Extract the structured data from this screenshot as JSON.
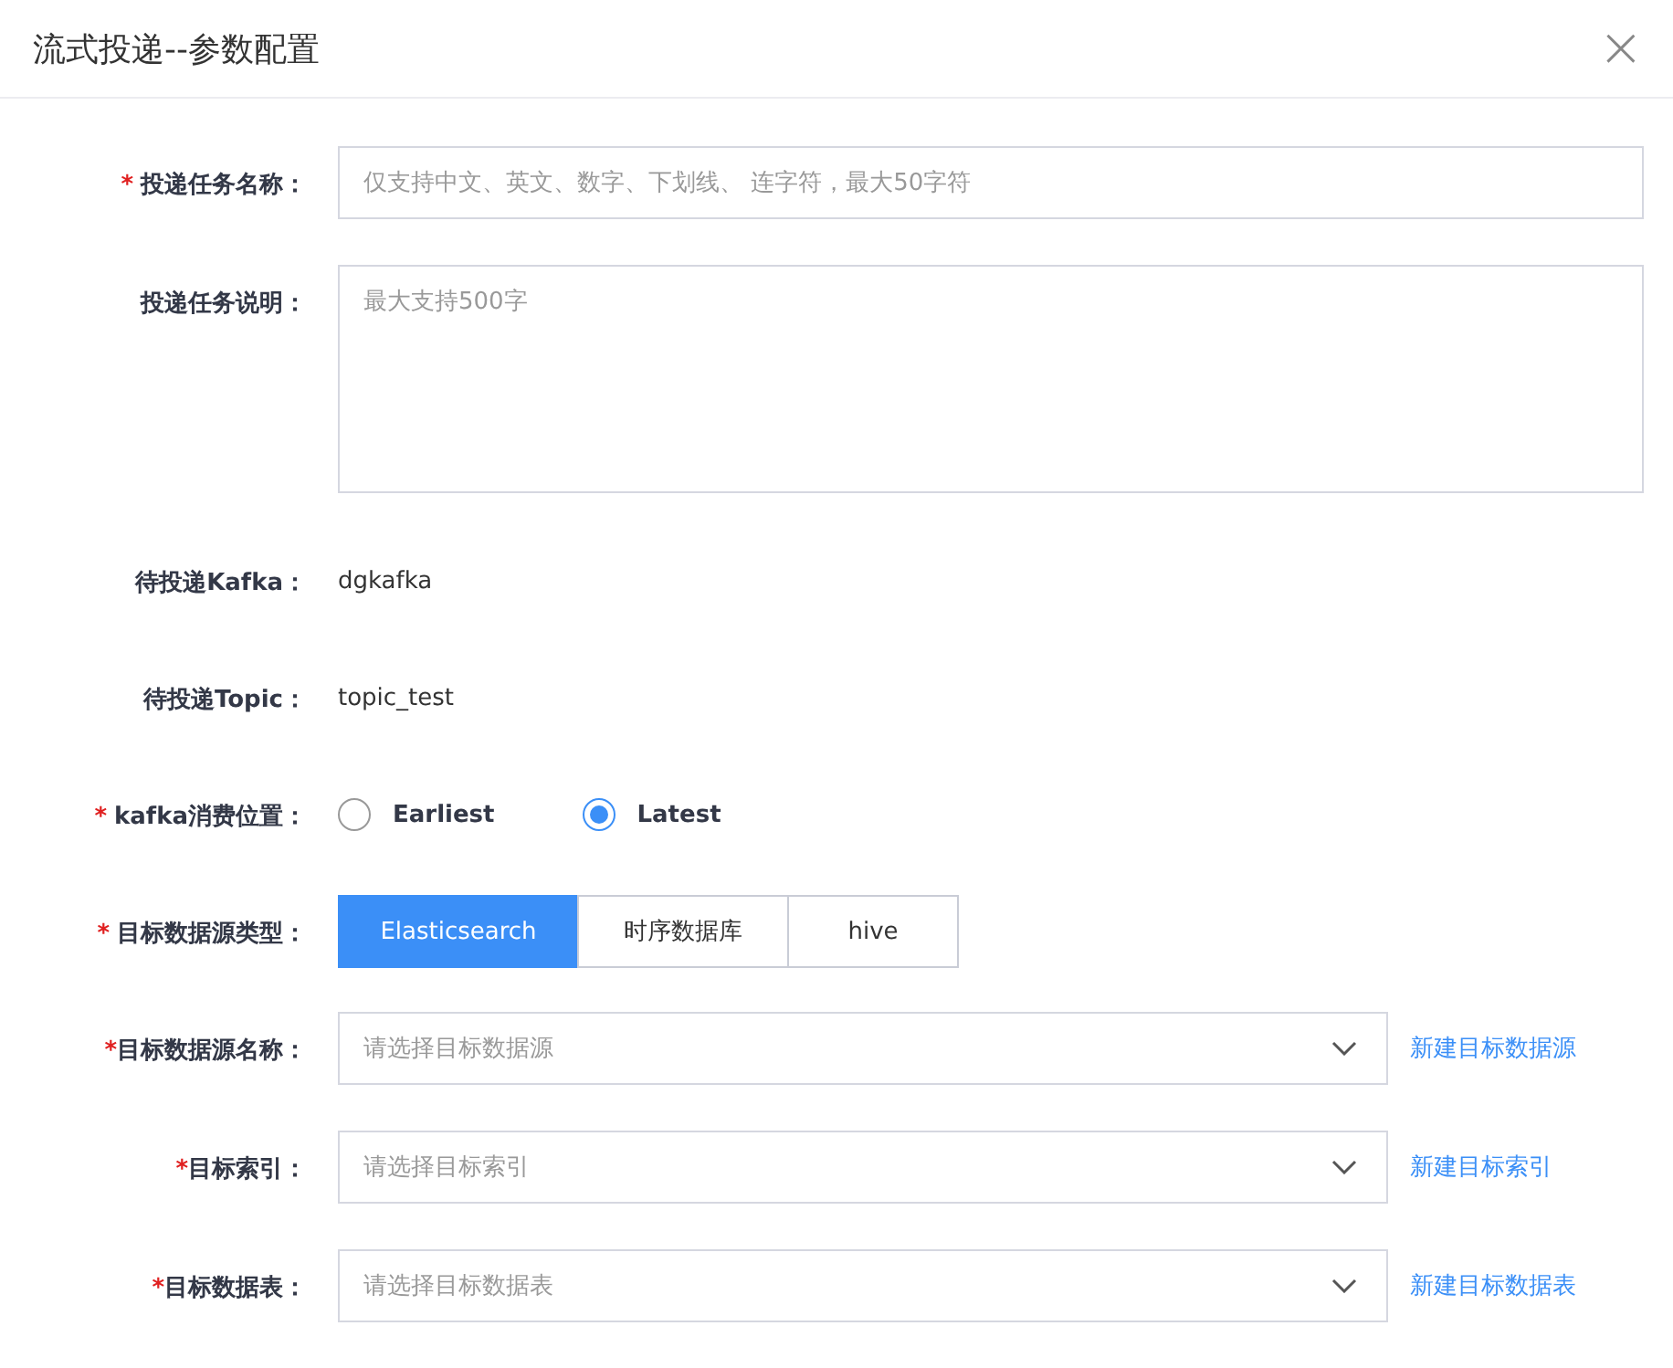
{
  "dialog": {
    "title": "流式投递--参数配置",
    "close": "×"
  },
  "fields": [
    {
      "kind": "input",
      "required": "*",
      "label": "投递任务名称：",
      "placeholder": "仅支持中文、英文、数字、下划线、 连字符，最大50字符"
    },
    {
      "kind": "textarea",
      "label": "投递任务说明：",
      "placeholder": "最大支持500字"
    },
    {
      "kind": "text",
      "label": "待投递Kafka：",
      "value": "dgkafka"
    },
    {
      "kind": "text",
      "label": "待投递Topic：",
      "value": "topic_test"
    },
    {
      "kind": "radio",
      "required": "*",
      "label": "kafka消费位置：",
      "options": [
        {
          "label": "Earliest",
          "selected": false
        },
        {
          "label": "Latest",
          "selected": true
        }
      ]
    },
    {
      "kind": "segmented",
      "required": "*",
      "label": "目标数据源类型：",
      "options": [
        {
          "label": "Elasticsearch",
          "selected": true
        },
        {
          "label": "时序数据库",
          "selected": false
        },
        {
          "label": "hive",
          "selected": false
        }
      ]
    },
    {
      "kind": "select",
      "required": "*",
      "label": "目标数据源名称：",
      "placeholder": "请选择目标数据源",
      "link": "新建目标数据源"
    },
    {
      "kind": "select",
      "required": "*",
      "label": "目标索引：",
      "placeholder": "请选择目标索引",
      "link": "新建目标索引"
    },
    {
      "kind": "select",
      "required": "*",
      "label": "目标数据表：",
      "placeholder": "请选择目标数据表",
      "link": "新建目标数据表"
    }
  ]
}
